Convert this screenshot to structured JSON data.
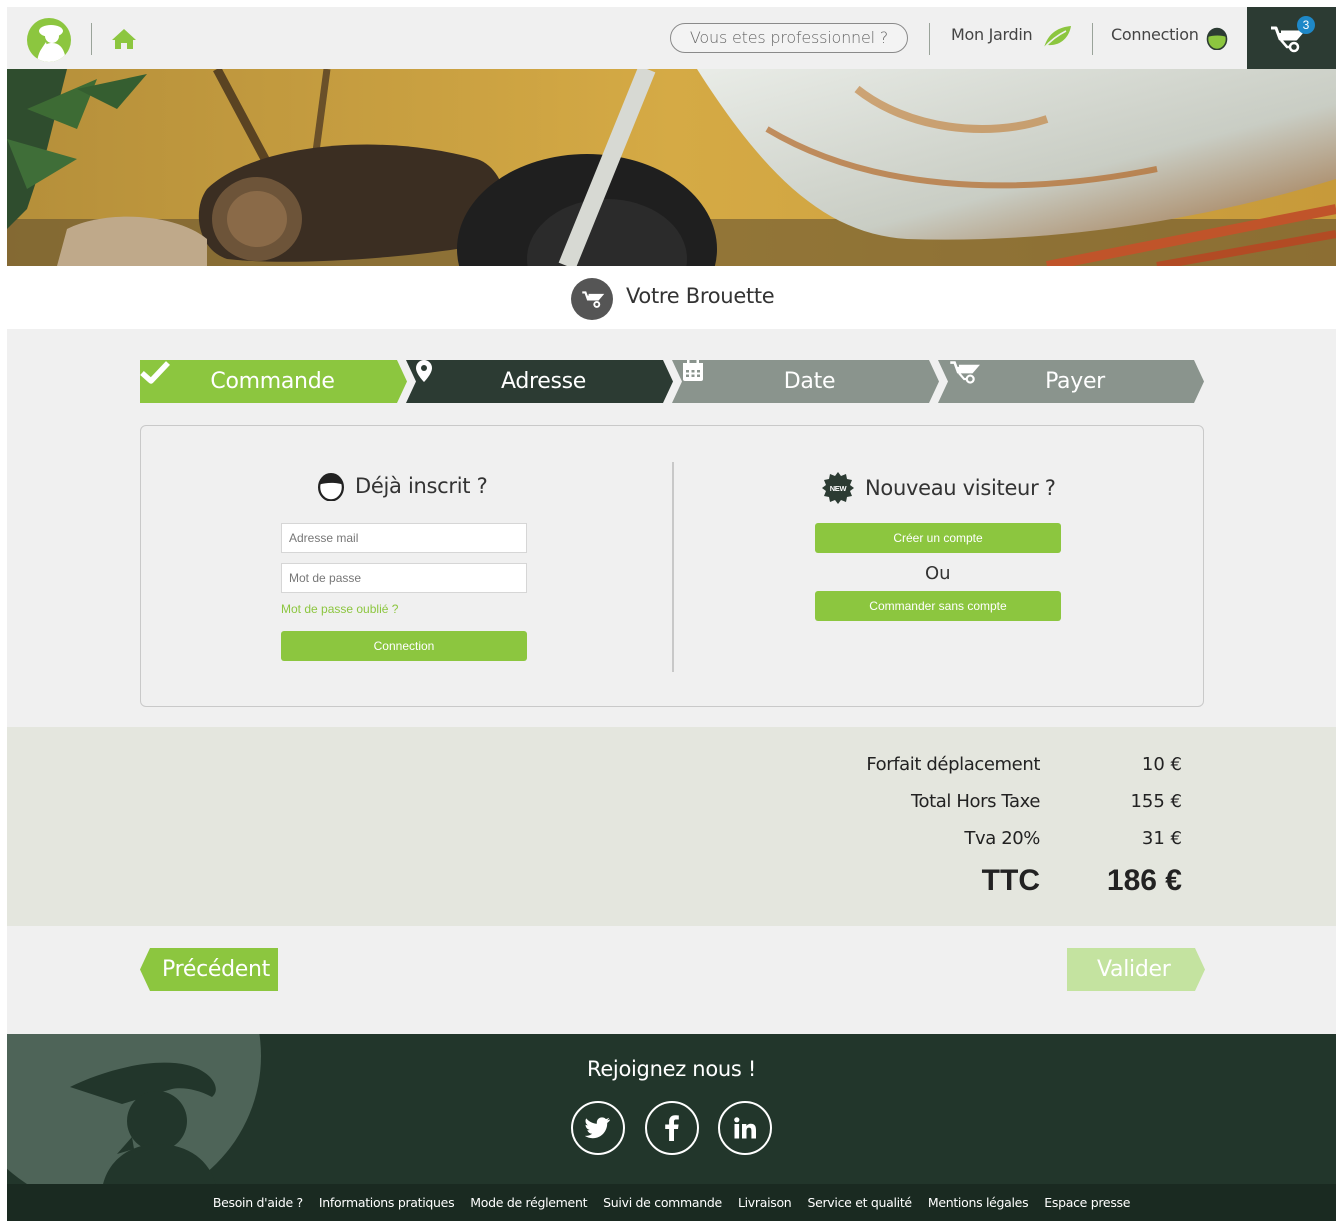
{
  "header": {
    "pro_label": "Vous etes professionnel ?",
    "garden_label": "Mon Jardin",
    "connection_label": "Connection",
    "cart_count": "3"
  },
  "page_title": "Votre Brouette",
  "steps": [
    {
      "label": "Commande",
      "state": "done",
      "color": "#8cc63f",
      "icon": "check-icon"
    },
    {
      "label": "Adresse",
      "state": "current",
      "color": "#2c3b33",
      "icon": "location-pin-icon"
    },
    {
      "label": "Date",
      "state": "upcoming",
      "color": "#8a948d",
      "icon": "calendar-icon"
    },
    {
      "label": "Payer",
      "state": "upcoming",
      "color": "#8a948d",
      "icon": "wheelbarrow-icon"
    }
  ],
  "login": {
    "title": "Déjà inscrit ?",
    "email_placeholder": "Adresse mail",
    "password_placeholder": "Mot de passe",
    "forgot_label": "Mot de passe oublié ?",
    "submit_label": "Connection"
  },
  "new_visitor": {
    "title": "Nouveau visiteur ?",
    "badge": "NEW",
    "create_label": "Créer un compte",
    "or_label": "Ou",
    "guest_label": "Commander sans compte"
  },
  "totals": {
    "travel_label": "Forfait déplacement",
    "travel_value": "10 €",
    "ht_label": "Total Hors Taxe",
    "ht_value": "155 €",
    "tva_label": "Tva 20%",
    "tva_value": "31 €",
    "ttc_label": "TTC",
    "ttc_value": "186 €"
  },
  "navigation": {
    "prev_label": "Précédent",
    "next_label": "Valider"
  },
  "footer": {
    "join_label": "Rejoignez nous !",
    "links": [
      "Besoin d'aide ?",
      "Informations pratiques",
      "Mode de réglement",
      "Suivi de commande",
      "Livraison",
      "Service et qualité",
      "Mentions légales",
      "Espace presse"
    ]
  },
  "colors": {
    "accent": "#8cc63f",
    "dark": "#2c3b33",
    "footer": "#22362b"
  }
}
